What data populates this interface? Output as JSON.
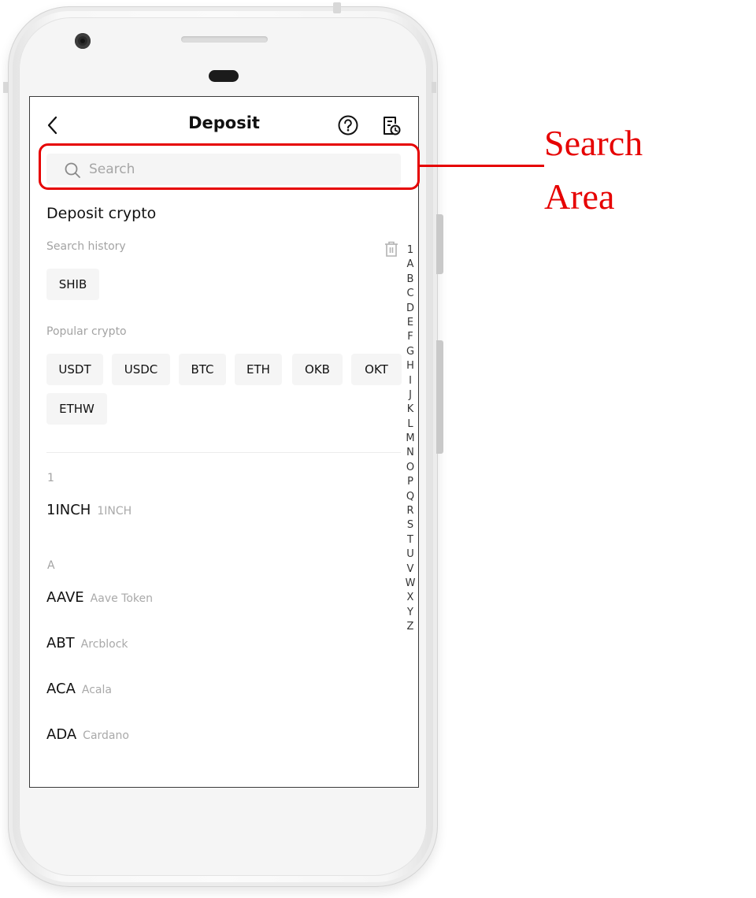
{
  "header": {
    "title": "Deposit",
    "back_icon": "chevron-left-icon",
    "help_icon": "question-circle-icon",
    "history_icon": "document-clock-icon"
  },
  "search": {
    "placeholder": "Search",
    "value": ""
  },
  "section": {
    "title": "Deposit crypto",
    "history_label": "Search history",
    "popular_label": "Popular crypto"
  },
  "history_chips": [
    "SHIB"
  ],
  "popular_chips": [
    "USDT",
    "USDC",
    "BTC",
    "ETH",
    "OKB",
    "OKT",
    "ETHW"
  ],
  "coin_groups": [
    {
      "label": "1",
      "coins": [
        {
          "symbol": "1INCH",
          "name": "1INCH"
        }
      ]
    },
    {
      "label": "A",
      "coins": [
        {
          "symbol": "AAVE",
          "name": "Aave Token"
        },
        {
          "symbol": "ABT",
          "name": "Arcblock"
        },
        {
          "symbol": "ACA",
          "name": "Acala"
        },
        {
          "symbol": "ADA",
          "name": "Cardano"
        }
      ]
    }
  ],
  "index_letters": [
    "1",
    "A",
    "B",
    "C",
    "D",
    "E",
    "F",
    "G",
    "H",
    "I",
    "J",
    "K",
    "L",
    "M",
    "N",
    "O",
    "P",
    "Q",
    "R",
    "S",
    "T",
    "U",
    "V",
    "W",
    "X",
    "Y",
    "Z"
  ],
  "annotation": {
    "line1": "Search",
    "line2": "Area",
    "color": "#e60000"
  }
}
